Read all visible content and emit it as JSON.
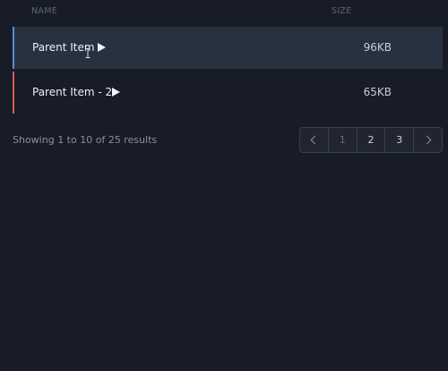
{
  "table": {
    "headers": {
      "name": "NAME",
      "size": "SIZE"
    },
    "rows": [
      {
        "label": "Parent Item",
        "size": "96KB",
        "accent": "#5b8bd6",
        "icon": "play-icon"
      },
      {
        "label": "Parent Item - 2",
        "size": "65KB",
        "accent": "#d85a5a",
        "icon": "play-icon"
      }
    ]
  },
  "footer": {
    "results_text": "Showing 1 to 10 of 25 results",
    "pages": [
      "1",
      "2",
      "3"
    ],
    "current_page": "1"
  },
  "colors": {
    "background": "#181c26",
    "selected_row": "#283140"
  }
}
